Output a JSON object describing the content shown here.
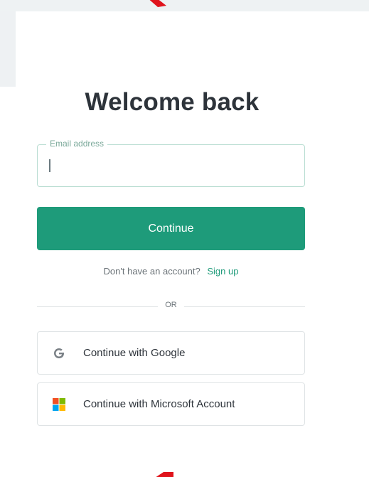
{
  "heading": {
    "title": "Welcome back"
  },
  "email": {
    "label": "Email address",
    "value": "",
    "placeholder": ""
  },
  "actions": {
    "continue_label": "Continue"
  },
  "signup": {
    "prompt": "Don't have an account?",
    "link_label": "Sign up"
  },
  "divider": {
    "text": "OR"
  },
  "social": {
    "google_label": "Continue with Google",
    "microsoft_label": "Continue with Microsoft Account"
  },
  "colors": {
    "accent": "#1e9b7a",
    "title": "#2d333a",
    "muted": "#6b7378",
    "border": "#dfe3e5",
    "input_border": "#b9ddd2",
    "annotation_red": "#e0141c"
  },
  "icons": {
    "google": "google-g-icon",
    "microsoft": "microsoft-logo-icon",
    "annotation": "red-arrow-icon"
  }
}
